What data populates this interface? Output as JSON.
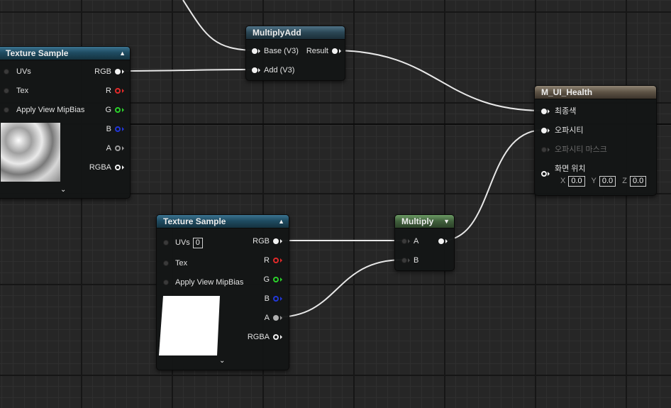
{
  "nodes": {
    "texture_sample_top": {
      "title": "Texture Sample",
      "inputs": [
        "UVs",
        "Tex",
        "Apply View MipBias"
      ],
      "outputs": [
        "RGB",
        "R",
        "G",
        "B",
        "A",
        "RGBA"
      ]
    },
    "multiply_add": {
      "title": "MultiplyAdd",
      "input_base": "Base (V3)",
      "input_add": "Add (V3)",
      "output": "Result"
    },
    "material_result": {
      "title": "M_UI_Health",
      "inputs": [
        "최종색",
        "오파시티",
        "오파시티 마스크",
        "화면 위치"
      ],
      "position": {
        "x_label": "X",
        "x": "0.0",
        "y_label": "Y",
        "y": "0.0",
        "z_label": "Z",
        "z": "0.0"
      }
    },
    "texture_sample_bottom": {
      "title": "Texture Sample",
      "inputs": [
        "UVs",
        "Tex",
        "Apply View MipBias"
      ],
      "uv_value": "0",
      "outputs": [
        "RGB",
        "R",
        "G",
        "B",
        "A",
        "RGBA"
      ]
    },
    "multiply": {
      "title": "Multiply",
      "inputs": [
        "A",
        "B"
      ]
    }
  },
  "colors": {
    "texture_header": "#2a5f78",
    "math_header": "#3a5a6a",
    "multiply_header": "#56804f",
    "result_header": "#7b6f5f",
    "pin_red": "#e22a2a",
    "pin_green": "#2bd12b",
    "pin_blue": "#2237d8",
    "wire": "#e8e8e8"
  }
}
